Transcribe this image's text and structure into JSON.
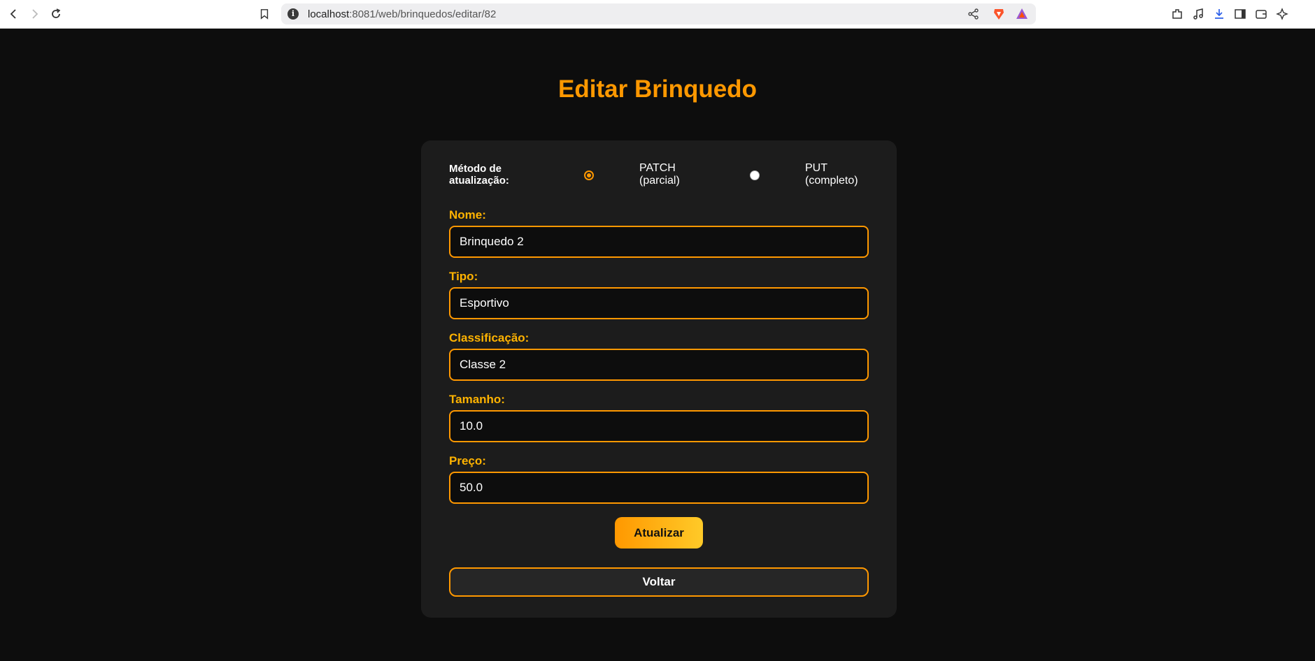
{
  "browser": {
    "url_host": "localhost",
    "url_path": ":8081/web/brinquedos/editar/82"
  },
  "page": {
    "title": "Editar Brinquedo"
  },
  "form": {
    "method_label": "Método de atualização:",
    "options": [
      {
        "label": "PATCH (parcial)",
        "selected": true
      },
      {
        "label": "PUT (completo)",
        "selected": false
      }
    ],
    "fields": {
      "nome": {
        "label": "Nome:",
        "value": "Brinquedo 2"
      },
      "tipo": {
        "label": "Tipo:",
        "value": "Esportivo"
      },
      "classificacao": {
        "label": "Classificação:",
        "value": "Classe 2"
      },
      "tamanho": {
        "label": "Tamanho:",
        "value": "10.0"
      },
      "preco": {
        "label": "Preço:",
        "value": "50.0"
      }
    },
    "submit_label": "Atualizar",
    "back_label": "Voltar"
  },
  "colors": {
    "accent": "#ff9800",
    "label": "#ffb300",
    "background": "#0d0d0d",
    "card": "#1c1c1c"
  }
}
